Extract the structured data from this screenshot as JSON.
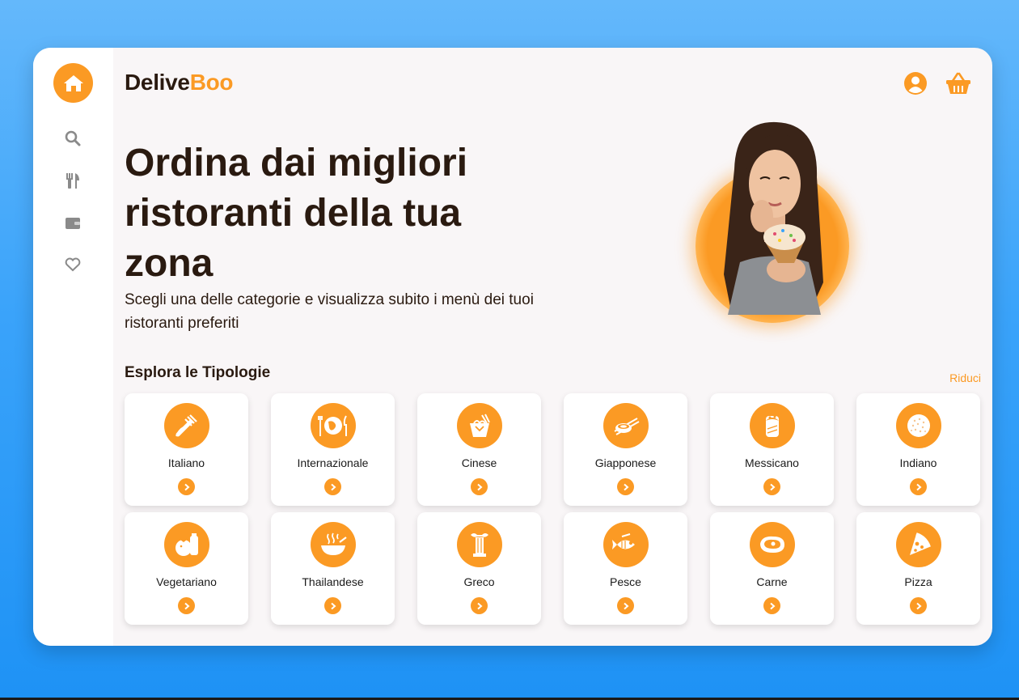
{
  "brand": {
    "name_part1": "Delive",
    "name_part2": "Boo",
    "accent_color": "#fb9a24"
  },
  "sidebar": {
    "items": [
      {
        "icon": "home-icon",
        "active": true
      },
      {
        "icon": "search-icon",
        "active": false
      },
      {
        "icon": "restaurant-icon",
        "active": false
      },
      {
        "icon": "wallet-icon",
        "active": false
      },
      {
        "icon": "heart-icon",
        "active": false
      }
    ]
  },
  "header": {
    "icons": [
      "user-icon",
      "basket-icon"
    ]
  },
  "hero": {
    "title": "Ordina dai migliori ristoranti della tua zona",
    "subtitle": "Scegli una delle categorie e visualizza subito i menù dei tuoi ristoranti preferiti"
  },
  "categories": {
    "title": "Esplora le Tipologie",
    "toggle_label": "Riduci",
    "items": [
      {
        "label": "Italiano",
        "icon": "pasta-icon"
      },
      {
        "label": "Internazionale",
        "icon": "globe-cutlery-icon"
      },
      {
        "label": "Cinese",
        "icon": "noodle-box-icon"
      },
      {
        "label": "Giapponese",
        "icon": "sushi-icon"
      },
      {
        "label": "Messicano",
        "icon": "burrito-icon"
      },
      {
        "label": "Indiano",
        "icon": "naan-icon"
      },
      {
        "label": "Vegetariano",
        "icon": "vegetables-icon"
      },
      {
        "label": "Thailandese",
        "icon": "hot-bowl-icon"
      },
      {
        "label": "Greco",
        "icon": "column-icon"
      },
      {
        "label": "Pesce",
        "icon": "fish-icon"
      },
      {
        "label": "Carne",
        "icon": "steak-icon"
      },
      {
        "label": "Pizza",
        "icon": "pizza-slice-icon"
      }
    ]
  }
}
